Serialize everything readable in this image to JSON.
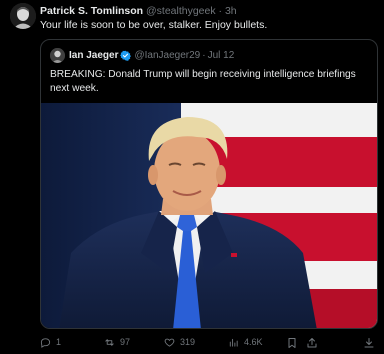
{
  "post": {
    "author_name": "Patrick S. Tomlinson",
    "handle": "@stealthygeek",
    "separator": "·",
    "time": "3h",
    "text": "Your life is soon to be over, stalker. Enjoy bullets."
  },
  "quote": {
    "author_name": "Ian Jaeger",
    "handle": "@IanJaeger29",
    "separator": "·",
    "time": "Jul 12",
    "text": "BREAKING: Donald Trump will begin receiving intelligence briefings next week."
  },
  "actions": {
    "replies": "1",
    "reposts": "97",
    "likes": "319",
    "views": "4.6K"
  },
  "colors": {
    "background": "#000000",
    "text_primary": "#e7e9ea",
    "text_secondary": "#71767b",
    "border": "#2f3336",
    "verified_blue": "#1d9bf0"
  },
  "icons": {
    "reply": "reply-icon",
    "repost": "repost-icon",
    "like": "heart-icon",
    "views": "views-icon",
    "bookmark": "bookmark-icon",
    "share": "share-icon",
    "verified": "verified-badge-icon"
  }
}
